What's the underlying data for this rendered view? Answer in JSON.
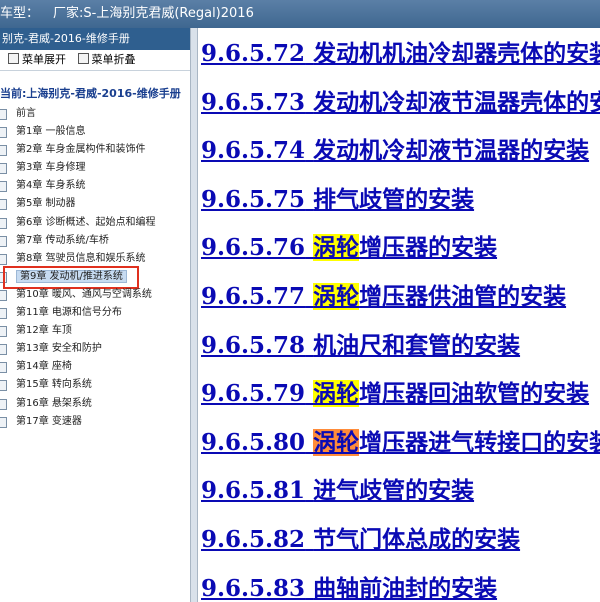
{
  "window": {
    "title_prefix": "车型：",
    "title_maker": "厂家:S-上海别克君威(Regal)2016"
  },
  "sidebar": {
    "header": "别克-君威-2016-维修手册",
    "expand_label": "菜单展开",
    "collapse_label": "菜单折叠",
    "current_label": "当前:上海别克-君威-2016-维修手册",
    "items": [
      {
        "label": "前言"
      },
      {
        "label": "第1章 一般信息"
      },
      {
        "label": "第2章 车身金属构件和装饰件"
      },
      {
        "label": "第3章 车身修理"
      },
      {
        "label": "第4章 车身系统"
      },
      {
        "label": "第5章 制动器"
      },
      {
        "label": "第6章 诊断概述、起始点和编程"
      },
      {
        "label": "第7章 传动系统/车桥"
      },
      {
        "label": "第8章 驾驶员信息和娱乐系统"
      },
      {
        "label": "第9章 发动机/推进系统"
      },
      {
        "label": "第10章 暖风、通风与空调系统"
      },
      {
        "label": "第11章 电源和信号分布"
      },
      {
        "label": "第12章 车顶"
      },
      {
        "label": "第13章 安全和防护"
      },
      {
        "label": "第14章 座椅"
      },
      {
        "label": "第15章 转向系统"
      },
      {
        "label": "第16章 悬架系统"
      },
      {
        "label": "第17章 变速器"
      }
    ],
    "selected_index": 9
  },
  "content": {
    "links": [
      {
        "num": "9.6.5.72",
        "highlight": "",
        "text": "发动机机油冷却器壳体的安装",
        "hl_style": ""
      },
      {
        "num": "9.6.5.73",
        "highlight": "",
        "text": "发动机冷却液节温器壳体的安装",
        "hl_style": ""
      },
      {
        "num": "9.6.5.74",
        "highlight": "",
        "text": "发动机冷却液节温器的安装",
        "hl_style": ""
      },
      {
        "num": "9.6.5.75",
        "highlight": "",
        "text": "排气歧管的安装",
        "hl_style": ""
      },
      {
        "num": "9.6.5.76",
        "highlight": "涡轮",
        "text": "增压器的安装",
        "hl_style": "yellow"
      },
      {
        "num": "9.6.5.77",
        "highlight": "涡轮",
        "text": "增压器供油管的安装",
        "hl_style": "yellow"
      },
      {
        "num": "9.6.5.78",
        "highlight": "",
        "text": "机油尺和套管的安装",
        "hl_style": ""
      },
      {
        "num": "9.6.5.79",
        "highlight": "涡轮",
        "text": "增压器回油软管的安装",
        "hl_style": "yellow"
      },
      {
        "num": "9.6.5.80",
        "highlight": "涡轮",
        "text": "增压器进气转接口的安装",
        "hl_style": "orange"
      },
      {
        "num": "9.6.5.81",
        "highlight": "",
        "text": "进气歧管的安装",
        "hl_style": ""
      },
      {
        "num": "9.6.5.82",
        "highlight": "",
        "text": "节气门体总成的安装",
        "hl_style": ""
      },
      {
        "num": "9.6.5.83",
        "highlight": "",
        "text": "曲轴前油封的安装",
        "hl_style": ""
      }
    ]
  },
  "colors": {
    "link": "#0a0ab4",
    "highlight_yellow": "#ffff00",
    "highlight_orange": "#ff8c3a",
    "selection_frame": "#e0301e",
    "titlebar": "#4a72a0"
  }
}
